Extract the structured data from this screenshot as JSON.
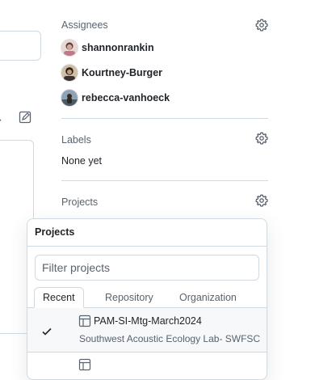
{
  "sidebar": {
    "assignees": {
      "heading": "Assignees",
      "items": [
        {
          "login": "shannonrankin"
        },
        {
          "login": "Kourtney-Burger"
        },
        {
          "login": "rebecca-vanhoeck"
        }
      ]
    },
    "labels": {
      "heading": "Labels",
      "value": "None yet"
    },
    "projects": {
      "heading": "Projects"
    }
  },
  "popover": {
    "title": "Projects",
    "filter_placeholder": "Filter projects",
    "tabs": [
      {
        "label": "Recent",
        "active": true
      },
      {
        "label": "Repository",
        "active": false
      },
      {
        "label": "Organization",
        "active": false
      }
    ],
    "projects": [
      {
        "title": "PAM-SI-Mtg-March2024",
        "description": "Southwest Acoustic Ecology Lab- SWFSC",
        "selected": true
      }
    ]
  },
  "icons": {
    "settings": "gear-icon",
    "selected": "check-icon",
    "project": "table-icon",
    "toolbar_left": [
      "sort-icon",
      "edit-square-icon"
    ]
  },
  "colors": {
    "text": "#1f2328",
    "muted": "#59636e",
    "border": "#d1d9e0",
    "row_highlight": "#f6f8fa"
  }
}
